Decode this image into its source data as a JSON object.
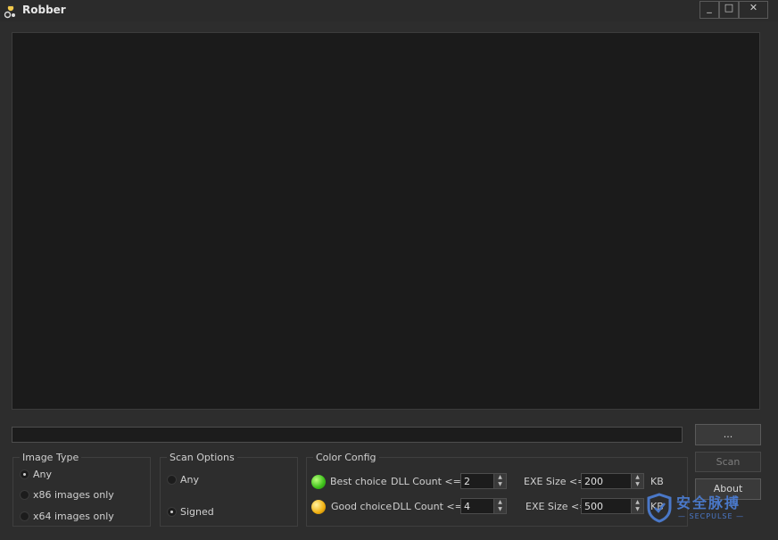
{
  "window": {
    "title": "Robber",
    "min_glyph": "_",
    "max_glyph": "□",
    "close_glyph": "✕"
  },
  "buttons": {
    "browse": "...",
    "scan": "Scan",
    "about": "About"
  },
  "image_type": {
    "title": "Image Type",
    "options": [
      "Any",
      "x86 images only",
      "x64 images only"
    ],
    "selected": "Any"
  },
  "scan_options": {
    "title": "Scan Options",
    "options": [
      "Any",
      "Signed"
    ],
    "selected": "Signed"
  },
  "color_config": {
    "title": "Color Config",
    "rows": [
      {
        "label": "Best choice",
        "color": "#3cbf1a",
        "dll_label": "DLL Count <=",
        "dll_value": "2",
        "exe_label": "EXE Size <=",
        "exe_value": "200",
        "unit": "KB"
      },
      {
        "label": "Good choice",
        "color": "#f0b010",
        "dll_label": "DLL Count <=",
        "dll_value": "4",
        "exe_label": "EXE Size <=",
        "exe_value": "500",
        "unit": "KB"
      }
    ]
  },
  "watermark": {
    "cn": "安全脉搏",
    "en": "— SECPULSE —"
  },
  "colors": {
    "background": "#2d2d2d",
    "output_bg": "#1b1b1b",
    "accent": "#4a78c8"
  }
}
